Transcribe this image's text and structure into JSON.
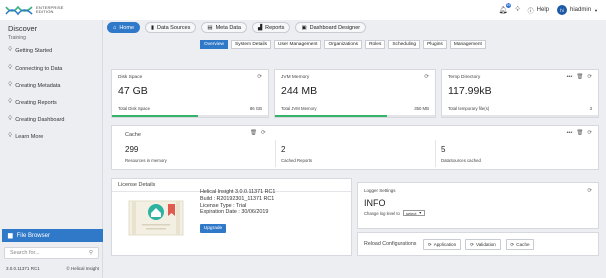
{
  "brand": {
    "edition_line1": "ENTERPRISE",
    "edition_line2": "EDITION"
  },
  "topbar": {
    "notif_count": "16",
    "help_label": "Help",
    "user_initials": "hi",
    "user_name": "hiadmin"
  },
  "sidebar": {
    "title": "Discover",
    "subtitle": "Training",
    "items": [
      {
        "label": "Getting Started"
      },
      {
        "label": "Connecting to Data"
      },
      {
        "label": "Creating Metadata"
      },
      {
        "label": "Creating Reports"
      },
      {
        "label": "Creating Dashboard"
      },
      {
        "label": "Learn More"
      }
    ],
    "file_browser": "File Browser",
    "search_placeholder": "Search for...",
    "version": "3.0.0.11371 RC1",
    "copyright": "© Helical Insight"
  },
  "nav": {
    "tabs": [
      {
        "label": "Home",
        "active": true
      },
      {
        "label": "Data Sources",
        "active": false
      },
      {
        "label": "Meta Data",
        "active": false
      },
      {
        "label": "Reports",
        "active": false
      },
      {
        "label": "Dashboard Designer",
        "active": false
      }
    ]
  },
  "subtabs": [
    "Overview",
    "System Details",
    "User Management",
    "Organizations",
    "Roles",
    "Scheduling",
    "Plugins",
    "Management"
  ],
  "colors": {
    "accent": "#2f79c8",
    "progress": "#35b36a"
  },
  "stats": {
    "disk": {
      "title": "Disk Space",
      "value": "47 GB",
      "left_label": "Total Disk Space",
      "right_label": "86 GB",
      "fill_fraction": 0.55
    },
    "jvm": {
      "title": "JVM Memory",
      "value": "244 MB",
      "left_label": "Total JVM Memory",
      "right_label": "350 MB",
      "fill_fraction": 0.7
    },
    "temp": {
      "title": "Temp Directory",
      "value": "117.99kB",
      "left_label": "Total temporary file(s)",
      "right_label": "3",
      "fill_fraction": 0.0
    }
  },
  "cache": {
    "title": "Cache",
    "metrics": [
      {
        "value": "299",
        "label": "Resources in memory"
      },
      {
        "value": "2",
        "label": "Cached Reports"
      },
      {
        "value": "5",
        "label": "DataSources cached"
      }
    ]
  },
  "license": {
    "title": "License Details",
    "product": "Helical Insight 3.0.0.11371 RC1",
    "build": "Build : R20192301_11371 RC1",
    "type": "License Type : Trial",
    "expiration": "Expiration Date : 30/06/2019",
    "upgrade_label": "Upgrade"
  },
  "logger": {
    "title": "Logger Settings",
    "level": "INFO",
    "change_label": "Change log level to",
    "select_value": "select"
  },
  "reload": {
    "title": "Reload Configurations",
    "buttons": [
      {
        "label": "Application"
      },
      {
        "label": "Validation"
      },
      {
        "label": "Cache"
      }
    ]
  }
}
